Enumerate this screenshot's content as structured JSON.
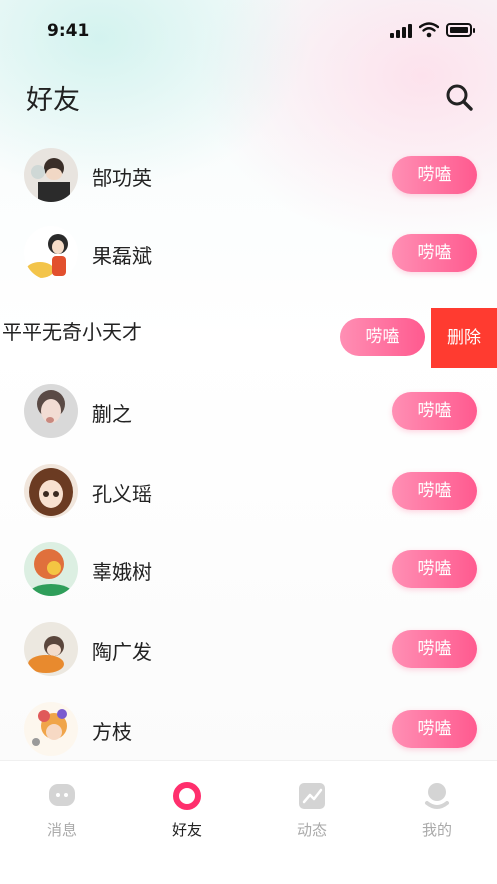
{
  "status_bar": {
    "time": "9:41"
  },
  "header": {
    "title": "好友",
    "search_icon": "search-icon"
  },
  "friends": [
    {
      "name": "郜功英",
      "action": "唠嗑"
    },
    {
      "name": "果磊斌",
      "action": "唠嗑"
    },
    {
      "name": "平平无奇小天才",
      "action": "唠嗑",
      "swiped": true,
      "delete_label": "删除"
    },
    {
      "name": "蒯之",
      "action": "唠嗑"
    },
    {
      "name": "孔义瑶",
      "action": "唠嗑"
    },
    {
      "name": "辜娥树",
      "action": "唠嗑"
    },
    {
      "name": "陶广发",
      "action": "唠嗑"
    },
    {
      "name": "方枝",
      "action": "唠嗑"
    }
  ],
  "tabs": [
    {
      "label": "消息",
      "icon": "message-icon"
    },
    {
      "label": "好友",
      "icon": "friends-ring-icon",
      "active": true
    },
    {
      "label": "动态",
      "icon": "trend-icon"
    },
    {
      "label": "我的",
      "icon": "profile-icon"
    }
  ],
  "colors": {
    "accent": "#ff5a8f",
    "accent_light": "#ff8fb4",
    "delete": "#ff3b30",
    "tab_active": "#ff2f6d"
  }
}
